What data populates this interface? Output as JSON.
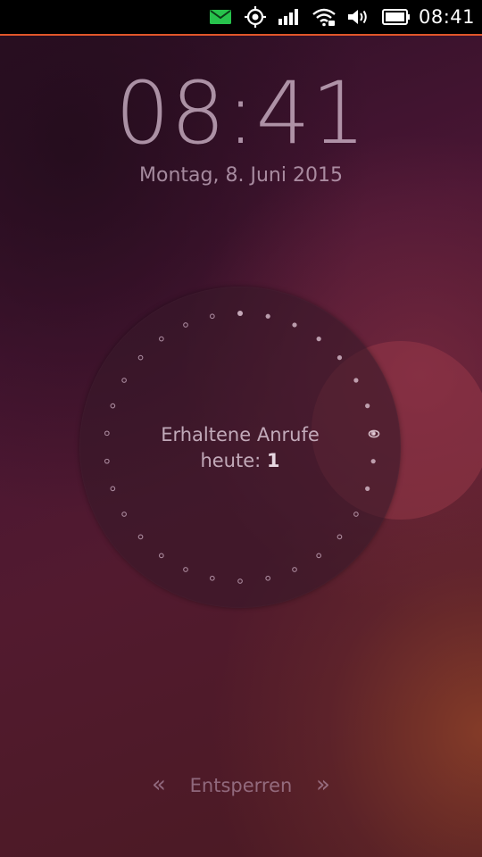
{
  "status_bar": {
    "icons": [
      "message-icon",
      "location-icon",
      "signal-icon",
      "wifi-icon",
      "volume-icon",
      "battery-icon"
    ],
    "time": "08:41",
    "message_color": "#2ecc40",
    "accent_color": "#e0562a"
  },
  "lockscreen": {
    "clock": "08:41",
    "date": "Montag, 8. Juni 2015"
  },
  "infographic": {
    "line1": "Erhaltene Anrufe",
    "line2_prefix": "heute: ",
    "count": "1",
    "filled_dots": 10,
    "total_dots": 30
  },
  "unlock": {
    "left_glyph": "«",
    "label": "Entsperren",
    "right_glyph": "»"
  }
}
